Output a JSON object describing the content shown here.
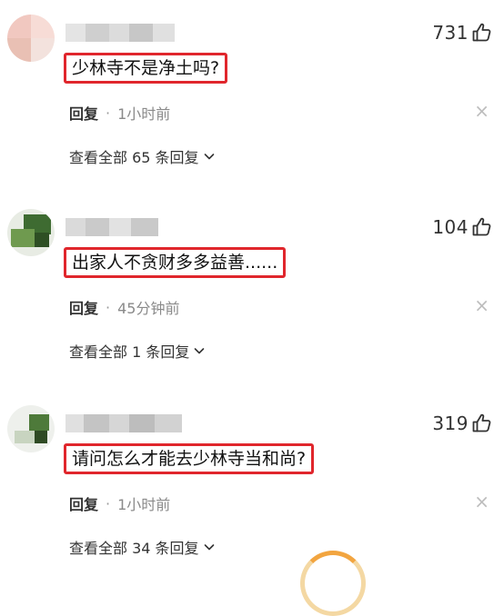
{
  "comments": [
    {
      "content": "少林寺不是净土吗?",
      "likes": "731",
      "reply_label": "回复",
      "separator": "·",
      "time": "1小时前",
      "close_icon": "×",
      "view_all": "查看全部 65 条回复"
    },
    {
      "content": "出家人不贪财多多益善......",
      "likes": "104",
      "reply_label": "回复",
      "separator": "·",
      "time": "45分钟前",
      "close_icon": "×",
      "view_all": "查看全部 1 条回复"
    },
    {
      "content": "请问怎么才能去少林寺当和尚?",
      "likes": "319",
      "reply_label": "回复",
      "separator": "·",
      "time": "1小时前",
      "close_icon": "×",
      "view_all": "查看全部 34 条回复"
    }
  ],
  "colors": {
    "highlight_border": "#e0262c",
    "spinner": "#f2a540"
  },
  "icons": {
    "like": "thumbs-up-icon",
    "expand": "chevron-down-icon",
    "close": "close-icon"
  }
}
